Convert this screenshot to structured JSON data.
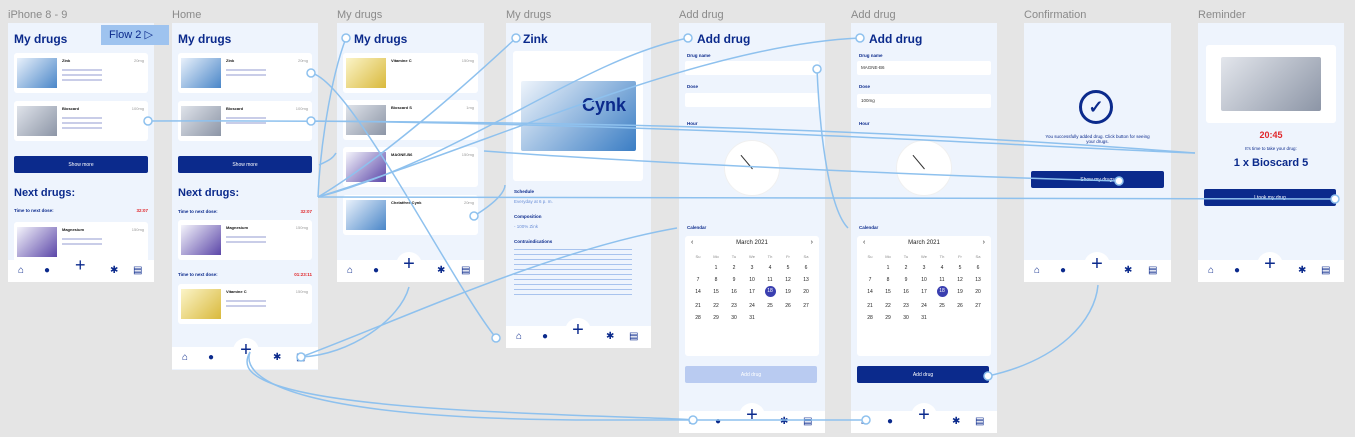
{
  "frames": [
    {
      "label": "iPhone 8 - 9",
      "title": "My drugs"
    },
    {
      "label": "Home",
      "title": "My drugs"
    },
    {
      "label": "My drugs",
      "title": "My drugs"
    },
    {
      "label": "My drugs",
      "title": "Zink"
    },
    {
      "label": "Add drug",
      "title": "Add drug"
    },
    {
      "label": "Add drug",
      "title": "Add drug"
    },
    {
      "label": "Confirmation"
    },
    {
      "label": "Reminder"
    }
  ],
  "flow_badge": "Flow 2",
  "cards": {
    "zink": "Zink",
    "bioscard": "Bioscard",
    "vitamin_c": "Vitamine C",
    "bioscard_s": "Bioscard S",
    "magne": "MAGNE-B6",
    "cynk": "Chelatfree Cynk",
    "magnesium": "Magnesium"
  },
  "doses": {
    "a": "20mg",
    "b": "100mg",
    "c": "1mg",
    "d": "150mg"
  },
  "show_more": "Show more",
  "next_drugs": "Next drugs:",
  "time_to_next": "Time to next dose:",
  "time1": "32:07",
  "time2": "01:23:11",
  "zink_detail": {
    "schedule": "Schedule",
    "schedule_val": "Everyday at 6 p. m.",
    "composition": "Composition",
    "composition_val": "- 100% Zink",
    "contraindications": "Contraindications"
  },
  "add_form": {
    "drug_name": "Drug name",
    "dose": "Dose",
    "hour": "Hour",
    "calendar": "Calendar",
    "month": "March 2021",
    "add_button": "Add drug",
    "name_value": "MAGNE-B6",
    "dose_value": "100mg"
  },
  "week_days": [
    "Su",
    "Mo",
    "Tu",
    "We",
    "Th",
    "Fr",
    "Sa"
  ],
  "days": [
    "",
    "1",
    "2",
    "3",
    "4",
    "5",
    "6",
    "7",
    "8",
    "9",
    "10",
    "11",
    "12",
    "13",
    "14",
    "15",
    "16",
    "17",
    "18",
    "19",
    "20",
    "21",
    "22",
    "23",
    "24",
    "25",
    "26",
    "27",
    "28",
    "29",
    "30",
    "31"
  ],
  "confirmation": {
    "message": "You successfully added drug. Click button for seeing your drugs.",
    "button": "Show my drugs"
  },
  "reminder": {
    "time": "20:45",
    "subtitle": "It's time to take your drug:",
    "drug": "1 x Bioscard 5",
    "button": "I took my drug"
  },
  "colors": {
    "brand": "#0b2a8c",
    "bg": "#eef4fd",
    "accent_red": "#e0262a",
    "wire": "#8ec1ee"
  }
}
